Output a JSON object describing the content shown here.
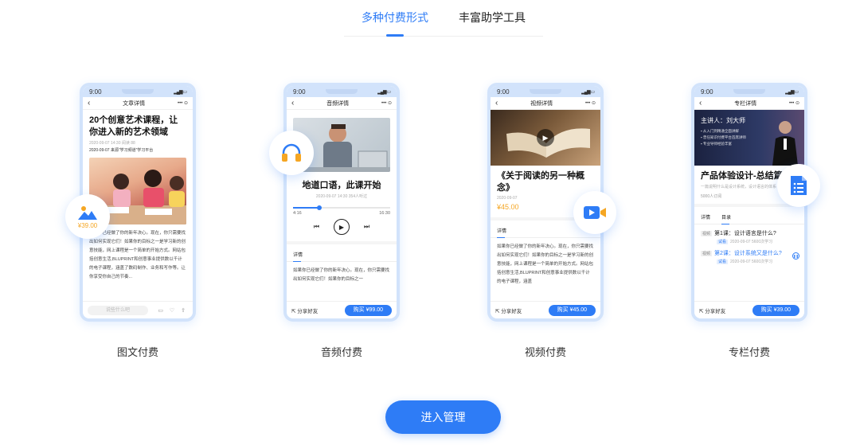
{
  "tabs": [
    {
      "label": "多种付费形式",
      "active": true
    },
    {
      "label": "丰富助学工具",
      "active": false
    }
  ],
  "colors": {
    "accent": "#2e7cf6",
    "price": "#f5a623"
  },
  "phone_time": "9:00",
  "cards": [
    {
      "label": "图文付费",
      "page_title": "文章详情",
      "content_title": "20个创意艺术课程，让你进入新的艺术领域",
      "meta": "2020-09-07 14:30 阅读 88",
      "meta2": "2020-09-07  来源“学习频道”学习平台",
      "price": "¥39.00",
      "para": "如果你已经做了你的新年决心。现在，你只需要找出如何实现它们！如果你的目标之一是学习新的创意技能，网上课程是一个简单的开始方式。网站包括创意生活,BLUPRINT和创意事业提供数以千计的电子课程，涵盖了数码制作、业务和写作等。让你享受你自己的节奏...",
      "comment_placeholder": "说些什么吧",
      "icon": "image-icon"
    },
    {
      "label": "音频付费",
      "page_title": "音频详情",
      "content_title": "地道口语，此课开始",
      "meta": "2020-09-07 14:30  354人听过",
      "time_start": "4:16",
      "time_end": "16:30",
      "progress": 0.27,
      "detail_tab": "详情",
      "para": "如果你已经做了你的新年决心。现在，你只需要找出如何实现它们！如果你的目标之一",
      "share": "分享好友",
      "buy": "购买 ¥99.00",
      "icon": "headphones-icon"
    },
    {
      "label": "视频付费",
      "page_title": "视频详情",
      "content_title": "《关于阅读的另一种概念》",
      "meta": "2020-09-07",
      "price": "¥45.00",
      "detail_tab": "详情",
      "para": "如果你已经做了你的新年决心。现在，你只需要找出如何实现它们！如果你的目标之一是学习新的创意技能，网上课程是一个简单的开始方式。网站包括创意生活,BLUPRINT和创意事业提供数以千计的电子课程，涵盖",
      "share": "分享好友",
      "buy": "购买 ¥45.00",
      "icon": "video-camera-icon"
    },
    {
      "label": "专栏付费",
      "page_title": "专栏详情",
      "speaker": "主讲人：刘大师",
      "bullets": [
        "从入门到精通全面讲解",
        "曾任知识付费平台首席讲师",
        "专业导师经验丰富"
      ],
      "content_title": "产品体验设计-总结篇",
      "subtitle": "一篇说明什么是设计系统，设计语言的体系",
      "count": "5000人订阅",
      "detail_tab": "详情",
      "toc_tab": "目录",
      "lessons": [
        {
          "tag": "视频",
          "title": "第1课：设计语言是什么?",
          "trial": "试看",
          "meta": "2020-09-07  5600次学习"
        },
        {
          "tag": "视频",
          "title": "第2课：设计系统又是什么?",
          "trial": "试看",
          "meta": "2020-09-07  5600次学习"
        }
      ],
      "share": "分享好友",
      "buy": "购买 ¥39.00",
      "icon": "document-list-icon"
    }
  ],
  "enter_button": "进入管理"
}
